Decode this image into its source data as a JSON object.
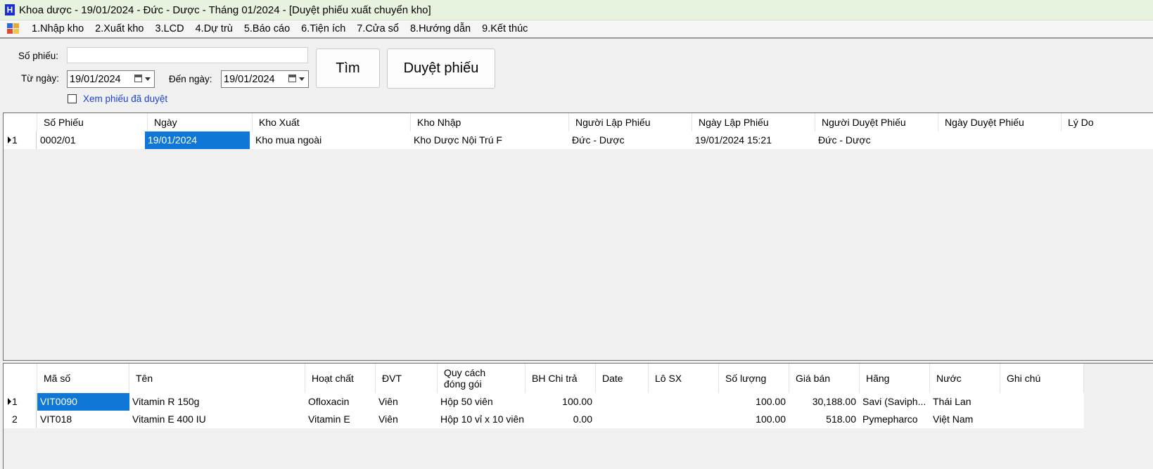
{
  "window": {
    "title": "Khoa dược - 19/01/2024 - Đức - Dược - Tháng 01/2024 - [Duyệt phiếu xuất chuyển kho]"
  },
  "menu": [
    {
      "label": "1.Nhập kho"
    },
    {
      "label": "2.Xuất kho"
    },
    {
      "label": "3.LCD"
    },
    {
      "label": "4.Dự trù"
    },
    {
      "label": "5.Báo cáo"
    },
    {
      "label": "6.Tiện ích"
    },
    {
      "label": "7.Cửa sổ"
    },
    {
      "label": "8.Hướng dẫn"
    },
    {
      "label": "9.Kết thúc"
    }
  ],
  "filter": {
    "so_phieu_label": "Số phiếu:",
    "so_phieu_value": "",
    "tu_ngay_label": "Từ ngày:",
    "tu_ngay_value": "19/01/2024",
    "den_ngay_label": "Đến ngày:",
    "den_ngay_value": "19/01/2024",
    "xem_label": "Xem phiếu đã duyệt",
    "tim_button": "Tìm",
    "duyet_button": "Duyệt phiếu"
  },
  "grid1": {
    "columns": [
      "Số Phiếu",
      "Ngày",
      "Kho Xuất",
      "Kho Nhập",
      "Người Lập Phiếu",
      "Ngày Lập Phiếu",
      "Người Duyệt Phiếu",
      "Ngày Duyệt Phiếu",
      "Lý Do"
    ],
    "rows": [
      {
        "num": "1",
        "cells": [
          "0002/01",
          "19/01/2024",
          "Kho mua ngoài",
          "Kho Dược Nội Trú F",
          "Đức - Dược",
          "19/01/2024 15:21",
          "Đức - Dược",
          "",
          ""
        ]
      }
    ]
  },
  "grid2": {
    "columns": [
      "Mã số",
      "Tên",
      "Hoạt chất",
      "ĐVT",
      "Quy cách\nđóng gói",
      "BH Chi trả",
      "Date",
      "Lô SX",
      "Số lượng",
      "Giá bán",
      "Hãng",
      "Nước",
      "Ghi chú"
    ],
    "rows": [
      {
        "num": "1",
        "cells": [
          "VIT0090",
          "Vitamin R 150g",
          "Ofloxacin",
          "Viên",
          "Hộp 50 viên",
          "100.00",
          "",
          "",
          "100.00",
          "30,188.00",
          "Savi (Saviph...",
          "Thái Lan",
          ""
        ]
      },
      {
        "num": "2",
        "cells": [
          "VIT018",
          "Vitamin E 400 IU",
          "Vitamin E",
          "Viên",
          "Hộp 10 vỉ x 10 viên",
          "0.00",
          "",
          "",
          "100.00",
          "518.00",
          "Pymepharco",
          "Việt Nam",
          ""
        ]
      }
    ]
  }
}
